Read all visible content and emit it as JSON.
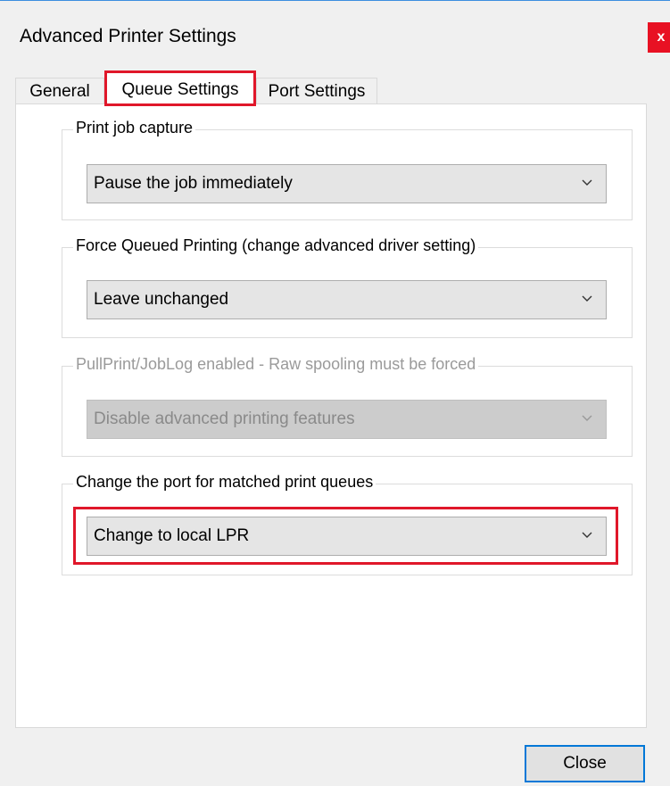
{
  "window": {
    "title": "Advanced Printer Settings",
    "close_glyph": "x"
  },
  "tabs": [
    {
      "label": "General"
    },
    {
      "label": "Queue Settings"
    },
    {
      "label": "Port Settings"
    }
  ],
  "groups": {
    "print_job_capture": {
      "legend": "Print job capture",
      "selected": "Pause the job immediately"
    },
    "force_queued": {
      "legend": "Force Queued Printing (change advanced driver setting)",
      "selected": "Leave unchanged"
    },
    "pullprint": {
      "legend": "PullPrint/JobLog enabled - Raw spooling must be forced",
      "selected": "Disable advanced printing features"
    },
    "change_port": {
      "legend": "Change the port for matched print queues",
      "selected": "Change to local LPR"
    }
  },
  "buttons": {
    "close_label": "Close"
  },
  "colors": {
    "highlight": "#e0172a",
    "close_x_bg": "#e81123",
    "default_button_border": "#0078d7"
  }
}
